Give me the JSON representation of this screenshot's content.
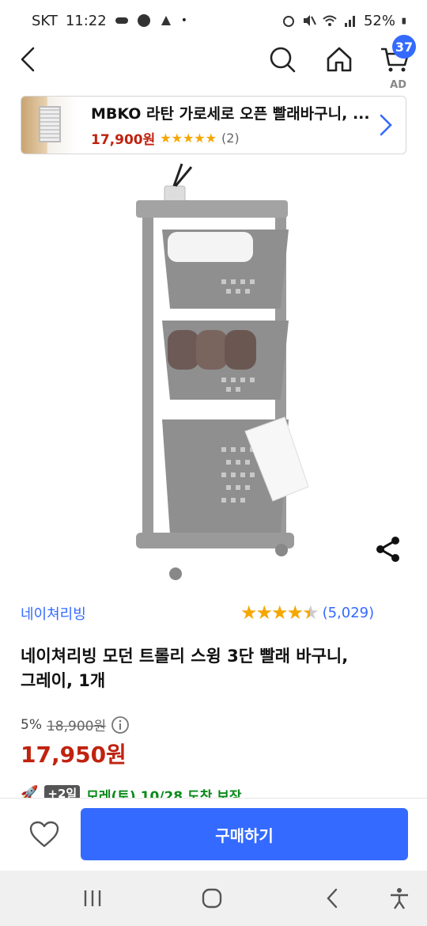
{
  "status_bar": {
    "carrier": "SKT",
    "time": "11:22",
    "battery": "52%"
  },
  "nav": {
    "cart_count": "37"
  },
  "ad": {
    "label": "AD",
    "title": "MBKO 라탄 가로세로 오픈 빨래바구니, ...",
    "price": "17,900원",
    "stars": "★★★★★",
    "review_count": "(2)"
  },
  "product": {
    "brand": "네이쳐리빙",
    "rating_stars": "★★★★",
    "rating_value": 4.5,
    "review_count": "(5,029)",
    "name": "네이쳐리빙 모던 트롤리 스윙 3단 빨래 바구니, 그레이, 1개",
    "discount_rate": "5%",
    "original_price": "18,900원",
    "final_price": "17,950원"
  },
  "delivery": {
    "rocket": "🚀",
    "plus": "+2일",
    "text": "모레(토) 10/28 도착 보장"
  },
  "actions": {
    "buy_label": "구매하기"
  },
  "colors": {
    "accent": "#346aff",
    "price": "#c0220f",
    "star": "#f5a700",
    "delivery": "#0a8a1a"
  }
}
